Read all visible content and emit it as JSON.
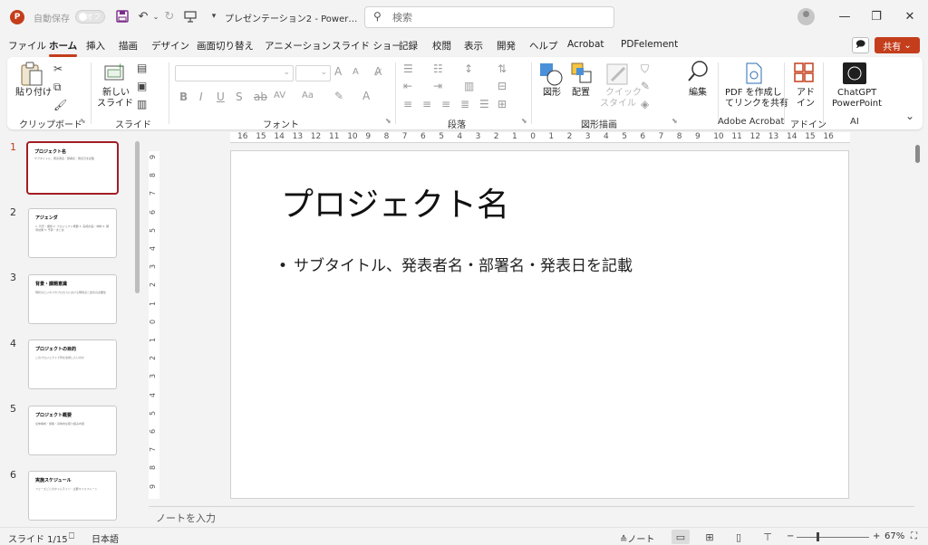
{
  "titlebar": {
    "autosave_label": "自動保存",
    "autosave_state": "オフ",
    "doc_title": "プレゼンテーション2 - Power…",
    "search_placeholder": "検索",
    "qat_icons": [
      "save-icon",
      "undo-icon",
      "redo-icon",
      "present-icon",
      "customize-icon"
    ],
    "window_icons": [
      "minimize-icon",
      "restore-icon",
      "close-icon"
    ]
  },
  "menu": {
    "tabs": [
      "ファイル",
      "ホーム",
      "挿入",
      "描画",
      "デザイン",
      "画面切り替え",
      "アニメーション",
      "スライド ショー",
      "記録",
      "校閲",
      "表示",
      "開発",
      "ヘルプ",
      "Acrobat",
      "PDFelement"
    ],
    "active_tab": "ホーム",
    "share_label": "共有"
  },
  "ribbon": {
    "paste": "貼り付け",
    "new_slide_line1": "新しい",
    "new_slide_line2": "スライド",
    "shapes": "図形",
    "arrange": "配置",
    "quick_style_line1": "クイック",
    "quick_style_line2": "スタイル",
    "editing": "編集",
    "pdf_line1": "PDF を作成し",
    "pdf_line2": "てリンクを共有",
    "addin_line1": "アド",
    "addin_line2": "イン",
    "chatgpt_line1": "ChatGPT",
    "chatgpt_line2": "PowerPoint",
    "groups": {
      "clipboard": "クリップボード",
      "slides": "スライド",
      "font": "フォント",
      "paragraph": "段落",
      "drawing": "図形描画",
      "adobe": "Adobe Acrobat",
      "addins": "アドイン",
      "ai": "AI"
    },
    "font_size_up": "A",
    "font_size_down": "A",
    "bold": "B",
    "italic": "I",
    "underline": "U",
    "shadow": "S",
    "strike": "ab",
    "spacing": "AV",
    "case": "Aa"
  },
  "thumbnails": [
    {
      "num": "1",
      "title": "プロジェクト名",
      "body": "サブタイトル、発表者名・部署名・発表日を記載"
    },
    {
      "num": "2",
      "title": "アジェンダ",
      "body": "1. 背景・課題 2. プロジェクト概要 3. 実施計画・体制 4. 期待効果 5. 予算・まとめ"
    },
    {
      "num": "3",
      "title": "背景・課題意識",
      "body": "現状のビジネスやプロセスにおける問題点と改善の必要性"
    },
    {
      "num": "4",
      "title": "プロジェクトの目的",
      "body": "このプロジェクトで何を達成したいのか"
    },
    {
      "num": "5",
      "title": "プロジェクト概要",
      "body": "全体構成・施策・具体的な取り組み内容"
    },
    {
      "num": "6",
      "title": "実施スケジュール",
      "body": "フェーズごとのタイムライン・主要マイルストーン"
    }
  ],
  "ruler": {
    "h": [
      "16",
      "15",
      "14",
      "13",
      "12",
      "11",
      "10",
      "9",
      "8",
      "7",
      "6",
      "5",
      "4",
      "3",
      "2",
      "1",
      "0",
      "1",
      "2",
      "3",
      "4",
      "5",
      "6",
      "7",
      "8",
      "9",
      "10",
      "11",
      "12",
      "13",
      "14",
      "15",
      "16"
    ],
    "v": [
      "9",
      "8",
      "7",
      "6",
      "5",
      "4",
      "3",
      "2",
      "1",
      "0",
      "1",
      "2",
      "3",
      "4",
      "5",
      "6",
      "7",
      "8",
      "9"
    ]
  },
  "slide": {
    "title": "プロジェクト名",
    "bullet": "•",
    "body": "サブタイトル、発表者名・部署名・発表日を記載"
  },
  "notes_placeholder": "ノートを入力",
  "status": {
    "slide_info": "スライド 1/15",
    "language": "日本語",
    "notes_label": "ノート",
    "zoom": "67%",
    "zoom_level": 0.27
  }
}
